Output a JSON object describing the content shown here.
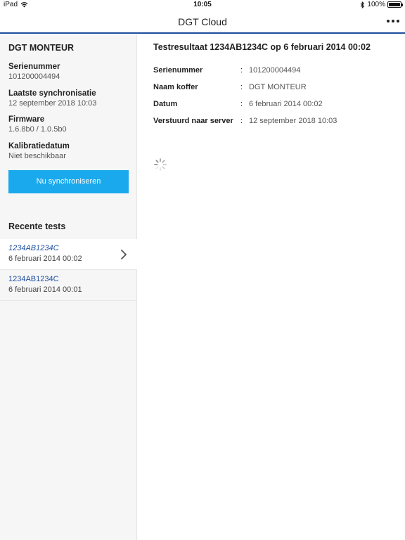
{
  "statusbar": {
    "device": "iPad",
    "time": "10:05",
    "battery": "100%"
  },
  "navbar": {
    "title": "DGT Cloud"
  },
  "sidebar": {
    "heading": "DGT MONTEUR",
    "info": [
      {
        "label": "Serienummer",
        "value": "101200004494"
      },
      {
        "label": "Laatste synchronisatie",
        "value": "12 september 2018 10:03"
      },
      {
        "label": "Firmware",
        "value": "1.6.8b0 / 1.0.5b0"
      },
      {
        "label": "Kalibratiedatum",
        "value": "Niet beschikbaar"
      }
    ],
    "sync_button": "Nu synchroniseren",
    "recent_title": "Recente tests",
    "tests": [
      {
        "code": "1234AB1234C",
        "date": "6 februari 2014 00:02",
        "selected": true
      },
      {
        "code": "1234AB1234C",
        "date": "6 februari 2014 00:01",
        "selected": false
      }
    ]
  },
  "main": {
    "title": "Testresultaat 1234AB1234C op 6 februari 2014 00:02",
    "separator": ":",
    "rows": [
      {
        "key": "Serienummer",
        "value": "101200004494"
      },
      {
        "key": "Naam koffer",
        "value": "DGT MONTEUR"
      },
      {
        "key": "Datum",
        "value": "6 februari 2014 00:02"
      },
      {
        "key": "Verstuurd naar server",
        "value": "12 september 2018 10:03"
      }
    ]
  },
  "icons": {
    "wifi": "wifi-icon",
    "bluetooth": "bluetooth-icon",
    "battery": "battery-icon",
    "more": "more-icon",
    "chevron": "chevron-right-icon",
    "spinner": "loading-spinner-icon"
  },
  "colors": {
    "accent_blue": "#1d4e9e",
    "button_blue": "#1aa9ec",
    "sidebar_bg": "#f6f6f6"
  }
}
